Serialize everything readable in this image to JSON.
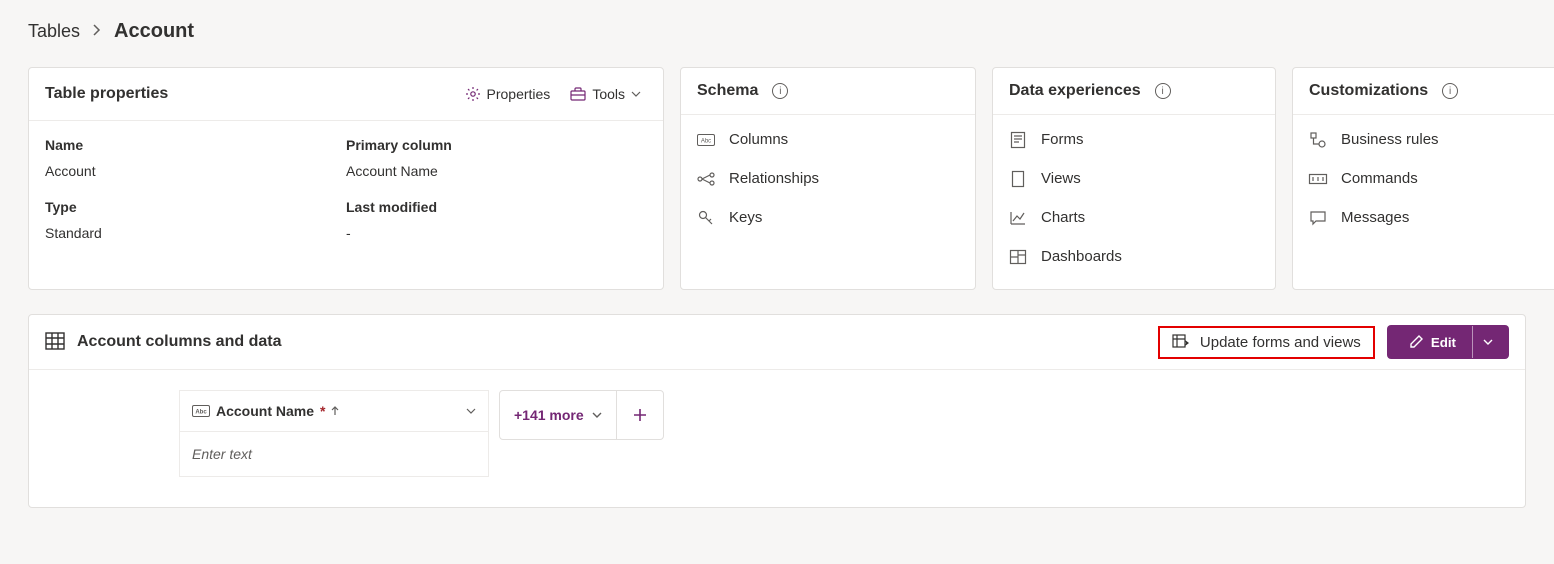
{
  "breadcrumb": {
    "root": "Tables",
    "current": "Account"
  },
  "properties_card": {
    "title": "Table properties",
    "actions": {
      "properties": "Properties",
      "tools": "Tools"
    },
    "fields": {
      "name_label": "Name",
      "name_value": "Account",
      "primary_label": "Primary column",
      "primary_value": "Account Name",
      "type_label": "Type",
      "type_value": "Standard",
      "modified_label": "Last modified",
      "modified_value": "-"
    }
  },
  "schema_card": {
    "title": "Schema",
    "items": {
      "columns": "Columns",
      "relationships": "Relationships",
      "keys": "Keys"
    }
  },
  "experiences_card": {
    "title": "Data experiences",
    "items": {
      "forms": "Forms",
      "views": "Views",
      "charts": "Charts",
      "dashboards": "Dashboards"
    }
  },
  "customizations_card": {
    "title": "Customizations",
    "items": {
      "rules": "Business rules",
      "commands": "Commands",
      "messages": "Messages"
    }
  },
  "data_panel": {
    "title": "Account columns and data",
    "update_btn": "Update forms and views",
    "edit_btn": "Edit",
    "column_header": "Account Name",
    "input_placeholder": "Enter text",
    "more_label": "+141 more"
  }
}
